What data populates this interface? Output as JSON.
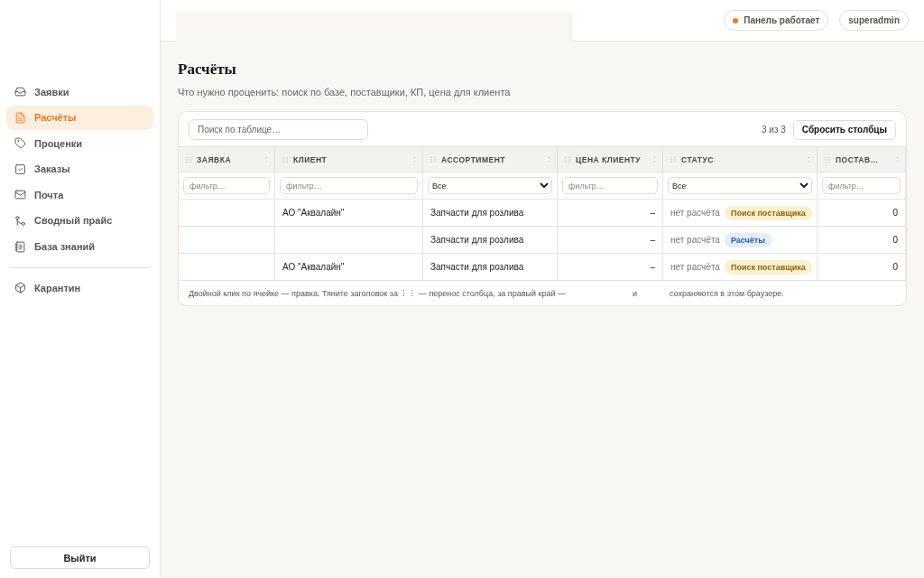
{
  "header": {
    "status": {
      "label": "Панель работает",
      "color": "#f07c1a"
    },
    "user": "superadmin"
  },
  "sidebar": {
    "items": [
      {
        "kind": "link",
        "label": "Заявки",
        "selected": false
      },
      {
        "kind": "link",
        "label": "Расчёты",
        "selected": true
      },
      {
        "kind": "link",
        "label": "Проценки",
        "selected": false
      },
      {
        "kind": "link",
        "label": "Заказы",
        "selected": false
      },
      {
        "kind": "link",
        "label": "Почта",
        "selected": false
      },
      {
        "kind": "link",
        "label": "Сводный прайс",
        "selected": false
      },
      {
        "kind": "link",
        "label": "База знаний",
        "selected": false
      },
      {
        "kind": "divider"
      },
      {
        "kind": "link",
        "label": "Карантин",
        "selected": false
      }
    ],
    "logout": "Выйти"
  },
  "page": {
    "title": "Расчёты",
    "subtitle": "Что нужно проценить: поиск по базе, поставщики, КП, цена для клиента"
  },
  "table": {
    "search": {
      "placeholder": "Поиск по таблице…"
    },
    "count": "3 из 3",
    "reset": "Сбросить столбцы",
    "columns": [
      {
        "label": "ЗАЯВКА",
        "filter": {
          "kind": "text",
          "placeholder": "фильтр…"
        }
      },
      {
        "label": "КЛИЕНТ",
        "filter": {
          "kind": "text",
          "placeholder": "фильтр…"
        }
      },
      {
        "label": "АССОРТИМЕНТ",
        "filter": {
          "kind": "select",
          "value": "Все"
        }
      },
      {
        "label": "ЦЕНА КЛИЕНТУ",
        "filter": {
          "kind": "text",
          "placeholder": "фильтр…"
        }
      },
      {
        "label": "СТАТУС",
        "filter": {
          "kind": "select",
          "value": "Все"
        }
      },
      {
        "label": "ПОСТАВ…",
        "filter": {
          "kind": "text",
          "placeholder": "фильтр…"
        }
      }
    ],
    "rows": [
      {
        "client": "АО \"Аквалайн\"",
        "assortment": "Запчасти для розлива",
        "price": "–",
        "calc": "нет расчёта",
        "status": {
          "label": "Поиск поставщика",
          "color": "#fbf0d0"
        },
        "suppliers": "0"
      },
      {
        "assortment": "Запчасти для розлива",
        "price": "–",
        "calc": "нет расчёта",
        "status": {
          "label": "Расчёты",
          "color": "#e3edfb"
        },
        "suppliers": "0"
      },
      {
        "client": "АО \"Аквалайн\"",
        "assortment": "Запчасти для розлива",
        "price": "–",
        "calc": "нет расчёта",
        "status": {
          "label": "Поиск поставщика",
          "color": "#fbf0d0"
        },
        "suppliers": "0"
      }
    ],
    "footer": [
      "Двойной клик по ячейке — правка. Тяните заголовок за ⋮⋮ — перенос столбца, за правый край —",
      "и",
      "сохраняются в этом браузере."
    ]
  }
}
